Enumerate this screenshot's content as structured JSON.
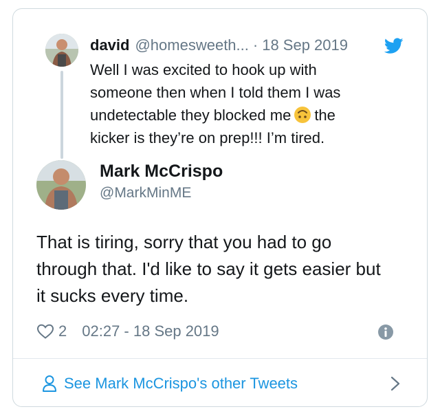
{
  "parent_tweet": {
    "name": "david",
    "handle": "@homesweeth...",
    "separator": "·",
    "date": "18 Sep 2019",
    "text_part1": "Well I was excited to hook up with someone then when I told them I was undetectable they blocked me",
    "emoji": "upside-down-face",
    "text_part2": "the kicker is they’re on prep!!! I’m tired."
  },
  "main_tweet": {
    "name": "Mark McCrispo",
    "handle": "@MarkMinME",
    "text": "That is tiring, sorry that you had to go through that. I'd like to say it gets easier but it sucks every time.",
    "likes": "2",
    "timestamp": "02:27 - 18 Sep 2019"
  },
  "footer": {
    "link_label": "See Mark McCrispo's other Tweets"
  },
  "icons": {
    "bird": "twitter-bird-icon",
    "heart": "heart-icon",
    "info": "info-icon",
    "person": "person-icon",
    "chevron": "chevron-right-icon"
  },
  "colors": {
    "accent": "#1b95e0",
    "muted": "#657786",
    "text": "#14171a",
    "border": "#cfd9de"
  }
}
